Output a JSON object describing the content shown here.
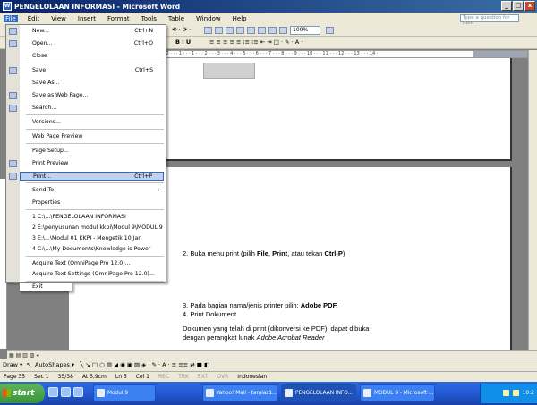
{
  "window": {
    "title": "PENGELOLAAN INFORMASI - Microsoft Word",
    "icon": "W"
  },
  "winbtns": {
    "min": "_",
    "max": "□",
    "close": "x"
  },
  "menubar": {
    "items": [
      "File",
      "Edit",
      "View",
      "Insert",
      "Format",
      "Tools",
      "Table",
      "Window",
      "Help"
    ],
    "help_placeholder": "Type a question for help"
  },
  "toolbar": {
    "zoom": "100%",
    "style": "",
    "font_icons": "B  I  U",
    "undo": "⟲ · ⟳ ·",
    "list_icons": "≡ ≡ ≡ ≡ ≡  ⁝≡  ⁝≡  ⇤ ⇥  □ · ✎ · A ·"
  },
  "file_menu": {
    "items": [
      {
        "label": "New...",
        "shortcut": "Ctrl+N"
      },
      {
        "label": "Open...",
        "shortcut": "Ctrl+O"
      },
      {
        "label": "Close",
        "shortcut": ""
      },
      {
        "label": "Save",
        "shortcut": "Ctrl+S"
      },
      {
        "label": "Save As...",
        "shortcut": ""
      },
      {
        "label": "Save as Web Page...",
        "shortcut": ""
      },
      {
        "label": "Search...",
        "shortcut": ""
      },
      {
        "label": "Versions...",
        "shortcut": ""
      },
      {
        "label": "Web Page Preview",
        "shortcut": ""
      },
      {
        "label": "Page Setup...",
        "shortcut": ""
      },
      {
        "label": "Print Preview",
        "shortcut": ""
      },
      {
        "label": "Print...",
        "shortcut": "Ctrl+P"
      },
      {
        "label": "Send To",
        "shortcut": ""
      },
      {
        "label": "Properties",
        "shortcut": ""
      },
      {
        "label": "1 C:\\...\\PENGELOLAAN INFORMASI",
        "shortcut": ""
      },
      {
        "label": "2 E:\\penyusunan modul kkpi\\Modul 9\\MODUL 9",
        "shortcut": ""
      },
      {
        "label": "3 E:\\...\\Modul 01 KKPI - Mengetik 10 Jari",
        "shortcut": ""
      },
      {
        "label": "4 C:\\...\\My Documents\\Knowledge is Power",
        "shortcut": ""
      },
      {
        "label": "Acquire Text (OmniPage Pro 12.0)...",
        "shortcut": ""
      },
      {
        "label": "Acquire Text Settings (OmniPage Pro 12.0)...",
        "shortcut": ""
      },
      {
        "label": "Exit",
        "shortcut": ""
      }
    ]
  },
  "document": {
    "step2_pre": "2.  Buka menu print (pilih ",
    "step2_file": "File",
    "step2_mid": ", ",
    "step2_print": "Print",
    "step2_post": ", atau tekan ",
    "step2_ctrl": "Ctrl-P",
    "step2_end": ")",
    "step3_pre": "3.  Pada bagian nama/jenis printer pilih: ",
    "step3_pdf": "Adobe PDF.",
    "step4": "4.  Print Dokument",
    "para1": "Dokumen yang telah di print (dikonversi ke PDF), dapat dibuka",
    "para2_pre": "dengan perangkat lunak ",
    "para2_it": "Adobe Acrobat Reader"
  },
  "ruler_text": "· · · 2 · · · 1 · · · 1 · · · 2 · · · 3 · · · 4 · · · 5 · · · 6 · · · 7 · · · 8 · · · 9 · · · 10 · · · 11 · · · 12 · · · 13 · · · 14 ·",
  "drawbar": {
    "draw": "Draw ▾",
    "autoshapes": "AutoShapes ▾",
    "tools": "╲  ↘  □  ○  ▤  ◢  ◉  ▣  ▨   ◈ ·  ✎ ·  A ·  ≡  ≡≡  ⇄  ■  ◧"
  },
  "statusbar": {
    "page": "Page 35",
    "sec": "Sec 1",
    "pos": "35/38",
    "at": "At 5,9cm",
    "ln": "Ln 5",
    "col": "Col 1",
    "rec": "REC",
    "trk": "TRK",
    "ext": "EXT",
    "ovr": "OVR",
    "lang": "Indonesian"
  },
  "taskbar": {
    "start": "start",
    "tasks": [
      "Modul 9",
      "Yahoo! Mail - tamiaz1...",
      "PENGELOLAAN INFO...",
      "MODUL 9 - Microsoft ..."
    ],
    "clock": "10:2"
  }
}
